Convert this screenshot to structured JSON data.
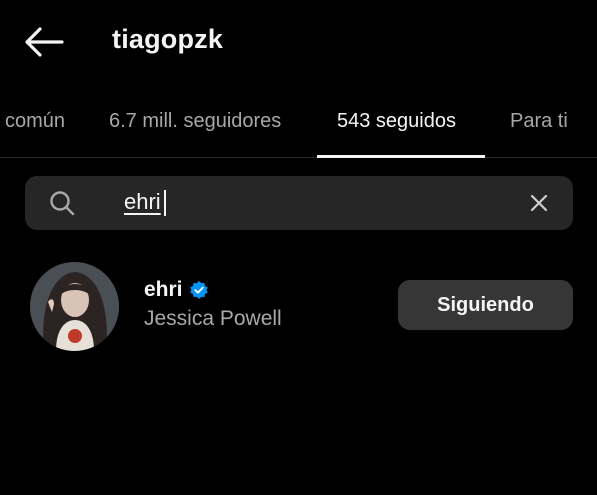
{
  "header": {
    "back_icon": "arrow-left-icon",
    "title": "tiagopzk"
  },
  "tabs": [
    {
      "label": "común",
      "active": false
    },
    {
      "label": "6.7 mill. seguidores",
      "active": false
    },
    {
      "label": "543 seguidos",
      "active": true
    },
    {
      "label": "Para ti",
      "active": false
    }
  ],
  "search": {
    "icon": "search-icon",
    "value": "ehri",
    "clear_icon": "close-icon"
  },
  "results": [
    {
      "username": "ehri",
      "verified": true,
      "full_name": "Jessica Powell",
      "button_label": "Siguiendo"
    }
  ],
  "colors": {
    "background": "#000000",
    "text_primary": "#f5f5f5",
    "text_secondary": "#a8a8a8",
    "search_bg": "#262626",
    "button_bg": "#363636",
    "verified_blue": "#0095f6"
  }
}
